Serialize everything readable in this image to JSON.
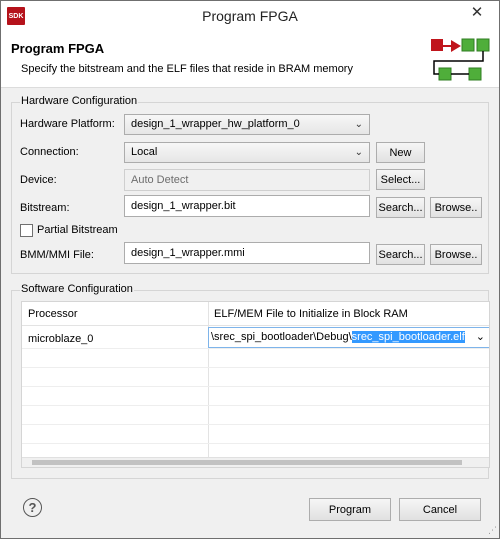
{
  "window": {
    "title": "Program FPGA",
    "app_icon_text": "SDK",
    "close_glyph": "✕"
  },
  "banner": {
    "title": "Program FPGA",
    "description": "Specify the bitstream and the ELF files that reside in BRAM memory"
  },
  "hardware": {
    "group_title": "Hardware Configuration",
    "platform_label": "Hardware Platform:",
    "platform_value": "design_1_wrapper_hw_platform_0",
    "connection_label": "Connection:",
    "connection_value": "Local",
    "new_button": "New",
    "device_label": "Device:",
    "device_value": "Auto Detect",
    "select_button": "Select...",
    "bitstream_label": "Bitstream:",
    "bitstream_value": "design_1_wrapper.bit",
    "search_button": "Search...",
    "browse_button": "Browse..",
    "partial_label": "Partial Bitstream",
    "bmm_label": "BMM/MMI File:",
    "bmm_value": "design_1_wrapper.mmi"
  },
  "software": {
    "group_title": "Software Configuration",
    "columns": [
      "Processor",
      "ELF/MEM File to Initialize in Block RAM"
    ],
    "rows": [
      {
        "processor": "microblaze_0",
        "elf_prefix": "\\srec_spi_bootloader\\Debug\\",
        "elf_selected": "srec_spi_bootloader.elf"
      }
    ]
  },
  "footer": {
    "help_glyph": "?",
    "program_button": "Program",
    "cancel_button": "Cancel"
  },
  "icons": {
    "chevron": "⌄",
    "dropdown": "⌵"
  },
  "colors": {
    "accent_red": "#c0151c",
    "accent_green": "#4fae3a",
    "selection": "#3399ff"
  }
}
